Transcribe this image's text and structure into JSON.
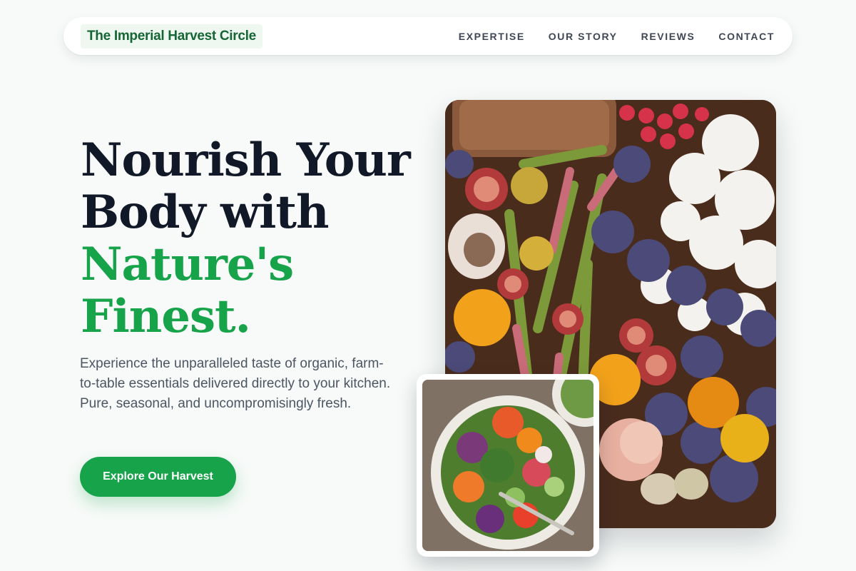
{
  "brand": {
    "name": "The Imperial Harvest Circle"
  },
  "nav": {
    "items": [
      {
        "label": "EXPERTISE"
      },
      {
        "label": "OUR STORY"
      },
      {
        "label": "REVIEWS"
      },
      {
        "label": "CONTACT"
      }
    ]
  },
  "hero": {
    "title_line1": "Nourish Your",
    "title_line2": "Body with",
    "title_accent_line1": "Nature's",
    "title_accent_line2": "Finest.",
    "subtitle": "Experience the unparalleled taste of organic, farm-to-table essentials delivered directly to your kitchen. Pure, seasonal, and uncompromisingly fresh.",
    "cta_label": "Explore Our Harvest"
  },
  "colors": {
    "accent": "#16a34a",
    "brand_text": "#166534",
    "heading": "#111827",
    "body_text": "#4b5563",
    "page_bg": "#f7faf8"
  },
  "images": {
    "main": "produce-spread-photo",
    "secondary": "salad-bowl-photo"
  }
}
